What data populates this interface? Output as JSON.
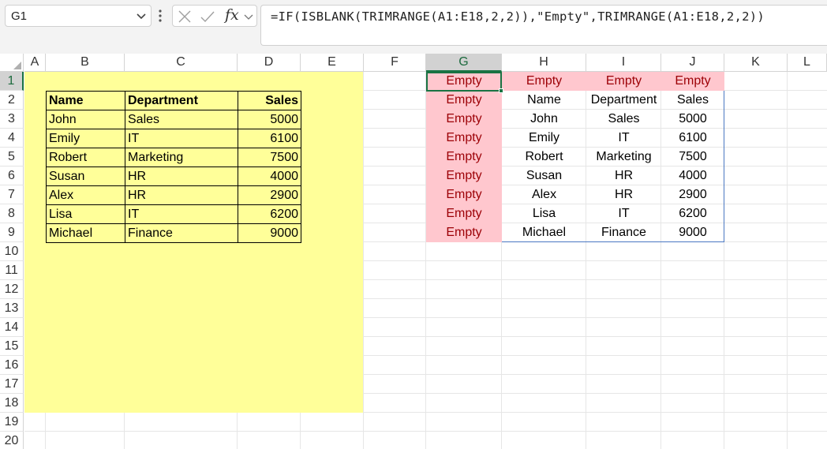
{
  "name_box": {
    "value": "G1"
  },
  "formula_bar": {
    "function_label": "fx",
    "formula": "=IF(ISBLANK(TRIMRANGE(A1:E18,2,2)),\"Empty\",TRIMRANGE(A1:E18,2,2))"
  },
  "columns": [
    "A",
    "B",
    "C",
    "D",
    "E",
    "F",
    "G",
    "H",
    "I",
    "J",
    "K",
    "L"
  ],
  "rows": [
    "1",
    "2",
    "3",
    "4",
    "5",
    "6",
    "7",
    "8",
    "9",
    "10",
    "11",
    "12",
    "13",
    "14",
    "15",
    "16",
    "17",
    "18",
    "19",
    "20"
  ],
  "selected_cell": {
    "column": "G",
    "row": "1"
  },
  "source_table": {
    "headers": [
      "Name",
      "Department",
      "Sales"
    ],
    "rows": [
      [
        "John",
        "Sales",
        "5000"
      ],
      [
        "Emily",
        "IT",
        "6100"
      ],
      [
        "Robert",
        "Marketing",
        "7500"
      ],
      [
        "Susan",
        "HR",
        "4000"
      ],
      [
        "Alex",
        "HR",
        "2900"
      ],
      [
        "Lisa",
        "IT",
        "6200"
      ],
      [
        "Michael",
        "Finance",
        "9000"
      ]
    ]
  },
  "spill_output": {
    "rows": [
      [
        "Empty",
        "Empty",
        "Empty",
        "Empty"
      ],
      [
        "Empty",
        "Name",
        "Department",
        "Sales"
      ],
      [
        "Empty",
        "John",
        "Sales",
        "5000"
      ],
      [
        "Empty",
        "Emily",
        "IT",
        "6100"
      ],
      [
        "Empty",
        "Robert",
        "Marketing",
        "7500"
      ],
      [
        "Empty",
        "Susan",
        "HR",
        "4000"
      ],
      [
        "Empty",
        "Alex",
        "HR",
        "2900"
      ],
      [
        "Empty",
        "Lisa",
        "IT",
        "6200"
      ],
      [
        "Empty",
        "Michael",
        "Finance",
        "9000"
      ]
    ]
  },
  "colors": {
    "fill_yellow": "#ffff99",
    "empty_fill": "#ffc7ce",
    "empty_text": "#9c0006",
    "selection_green": "#1a7343",
    "spill_border": "#4a78c2"
  }
}
